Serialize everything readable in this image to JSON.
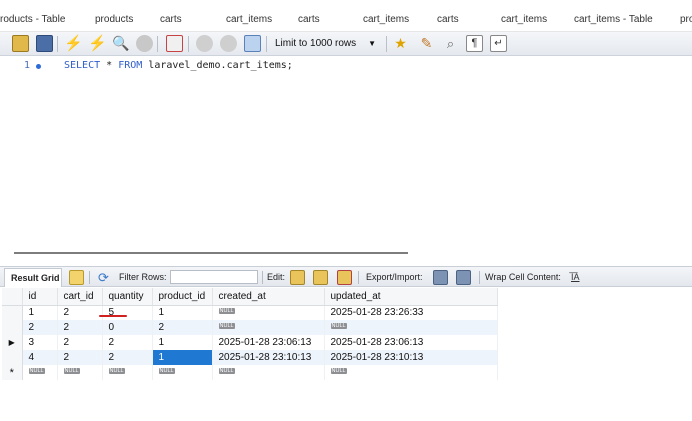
{
  "tabs": [
    "roducts - Table",
    "products",
    "carts",
    "cart_items",
    "carts",
    "cart_items",
    "carts",
    "cart_items",
    "cart_items - Table",
    "pro"
  ],
  "toolbar": {
    "limit_label": "Limit to 1000 rows",
    "icons": [
      "open-folder-icon",
      "save-icon",
      "execute-icon",
      "execute-current-icon",
      "explain-icon",
      "stop-icon",
      "error-toggle-icon",
      "commit-icon",
      "rollback-icon",
      "autocommit-icon",
      "beautify-icon",
      "find-icon",
      "invisible-chars-icon",
      "wrap-icon"
    ]
  },
  "editor": {
    "line_number": "1",
    "sql": {
      "kw1": "SELECT",
      "star": " * ",
      "kw2": "FROM",
      "rest": " laravel_demo.cart_items;"
    }
  },
  "result_bar": {
    "result_grid": "Result Grid",
    "filter_rows": "Filter Rows:",
    "edit": "Edit:",
    "export_import": "Export/Import:",
    "wrap": "Wrap Cell Content:",
    "wrap_icon_glyph": "I͞A"
  },
  "grid": {
    "columns": [
      "id",
      "cart_id",
      "quantity",
      "product_id",
      "created_at",
      "updated_at"
    ],
    "null_label": "NULL",
    "rows": [
      [
        "1",
        "2",
        "5",
        "1",
        null,
        "2025-01-28 23:26:33"
      ],
      [
        "2",
        "2",
        "0",
        "2",
        null,
        null
      ],
      [
        "3",
        "2",
        "2",
        "1",
        "2025-01-28 23:06:13",
        "2025-01-28 23:06:13"
      ],
      [
        "4",
        "2",
        "2",
        "1",
        "2025-01-28 23:10:13",
        "2025-01-28 23:10:13"
      ],
      [
        null,
        null,
        null,
        null,
        null,
        null
      ]
    ],
    "current_row_marker": "▶",
    "new_row_marker": "*"
  }
}
